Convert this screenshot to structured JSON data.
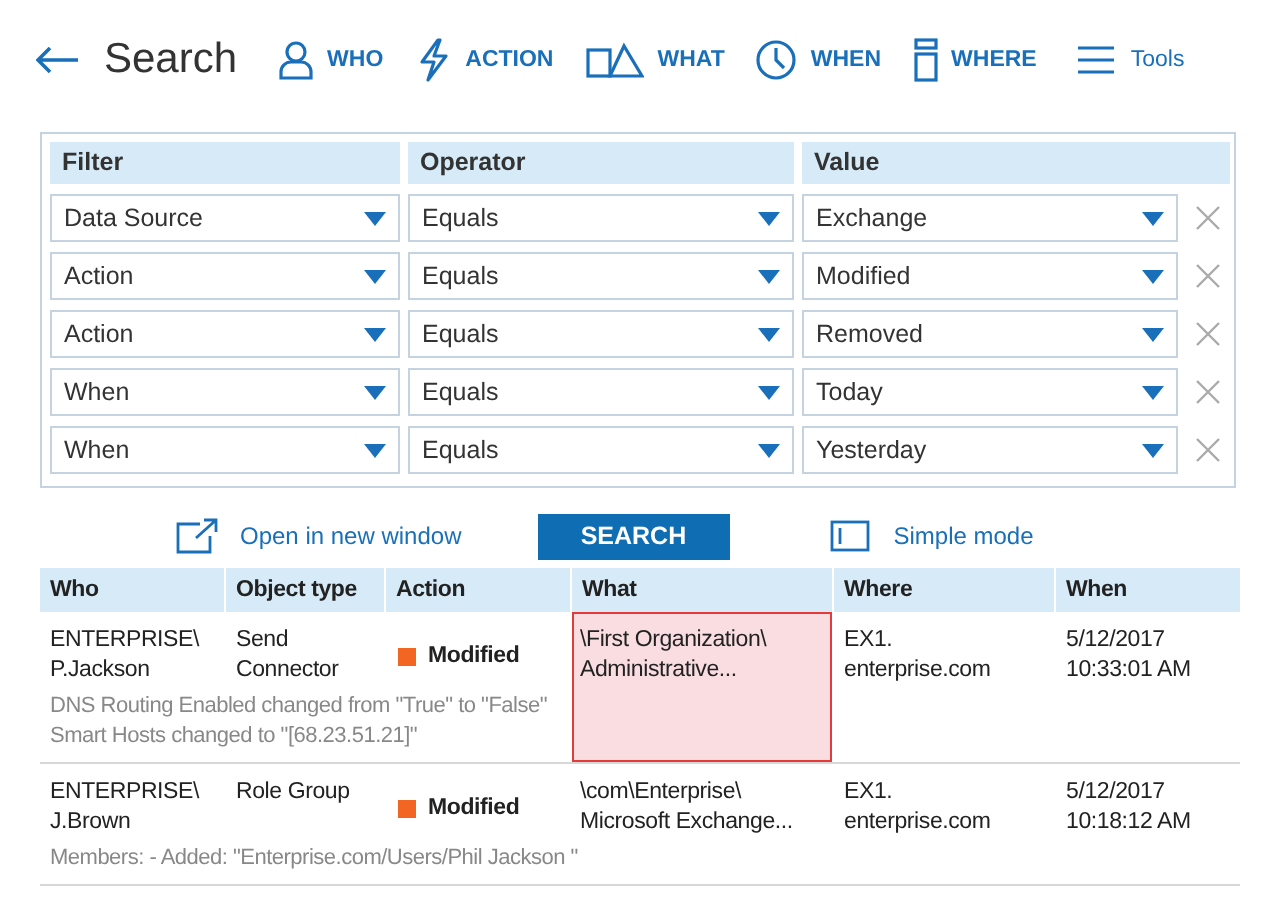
{
  "header": {
    "title": "Search",
    "nav": [
      {
        "kind": "who",
        "label": "WHO"
      },
      {
        "kind": "action",
        "label": "ACTION"
      },
      {
        "kind": "what",
        "label": "WHAT"
      },
      {
        "kind": "when",
        "label": "WHEN"
      },
      {
        "kind": "where",
        "label": "WHERE"
      }
    ],
    "tools": "Tools"
  },
  "filters": {
    "columns": [
      "Filter",
      "Operator",
      "Value"
    ],
    "rows": [
      {
        "filter": "Data Source",
        "operator": "Equals",
        "value": "Exchange"
      },
      {
        "filter": "Action",
        "operator": "Equals",
        "value": "Modified"
      },
      {
        "filter": "Action",
        "operator": "Equals",
        "value": "Removed"
      },
      {
        "filter": "When",
        "operator": "Equals",
        "value": "Today"
      },
      {
        "filter": "When",
        "operator": "Equals",
        "value": "Yesterday"
      }
    ]
  },
  "actions": {
    "open_new_window": "Open in new window",
    "search": "SEARCH",
    "simple_mode": "Simple mode"
  },
  "results": {
    "columns": [
      "Who",
      "Object type",
      "Action",
      "What",
      "Where",
      "When"
    ],
    "rows": [
      {
        "who": "ENTERPRISE\\ P.Jackson",
        "object_type": "Send Connector",
        "action": "Modified",
        "color": "#f26522",
        "what": "\\First Organization\\ Administrative...",
        "where": "EX1. enterprise.com",
        "when": "5/12/2017 10:33:01 AM",
        "details": [
          "DNS Routing Enabled changed from \"True\" to \"False\"",
          "Smart Hosts changed to \"[68.23.51.21]\""
        ],
        "selected": true
      },
      {
        "who": "ENTERPRISE\\ J.Brown",
        "object_type": "Role Group",
        "action": "Modified",
        "color": "#f26522",
        "what": "\\com\\Enterprise\\ Microsoft Exchange...",
        "where": "EX1. enterprise.com",
        "when": "5/12/2017 10:18:12 AM",
        "details": [
          "Members: - Added: \"Enterprise.com/Users/Phil Jackson \""
        ],
        "selected": false
      }
    ]
  }
}
